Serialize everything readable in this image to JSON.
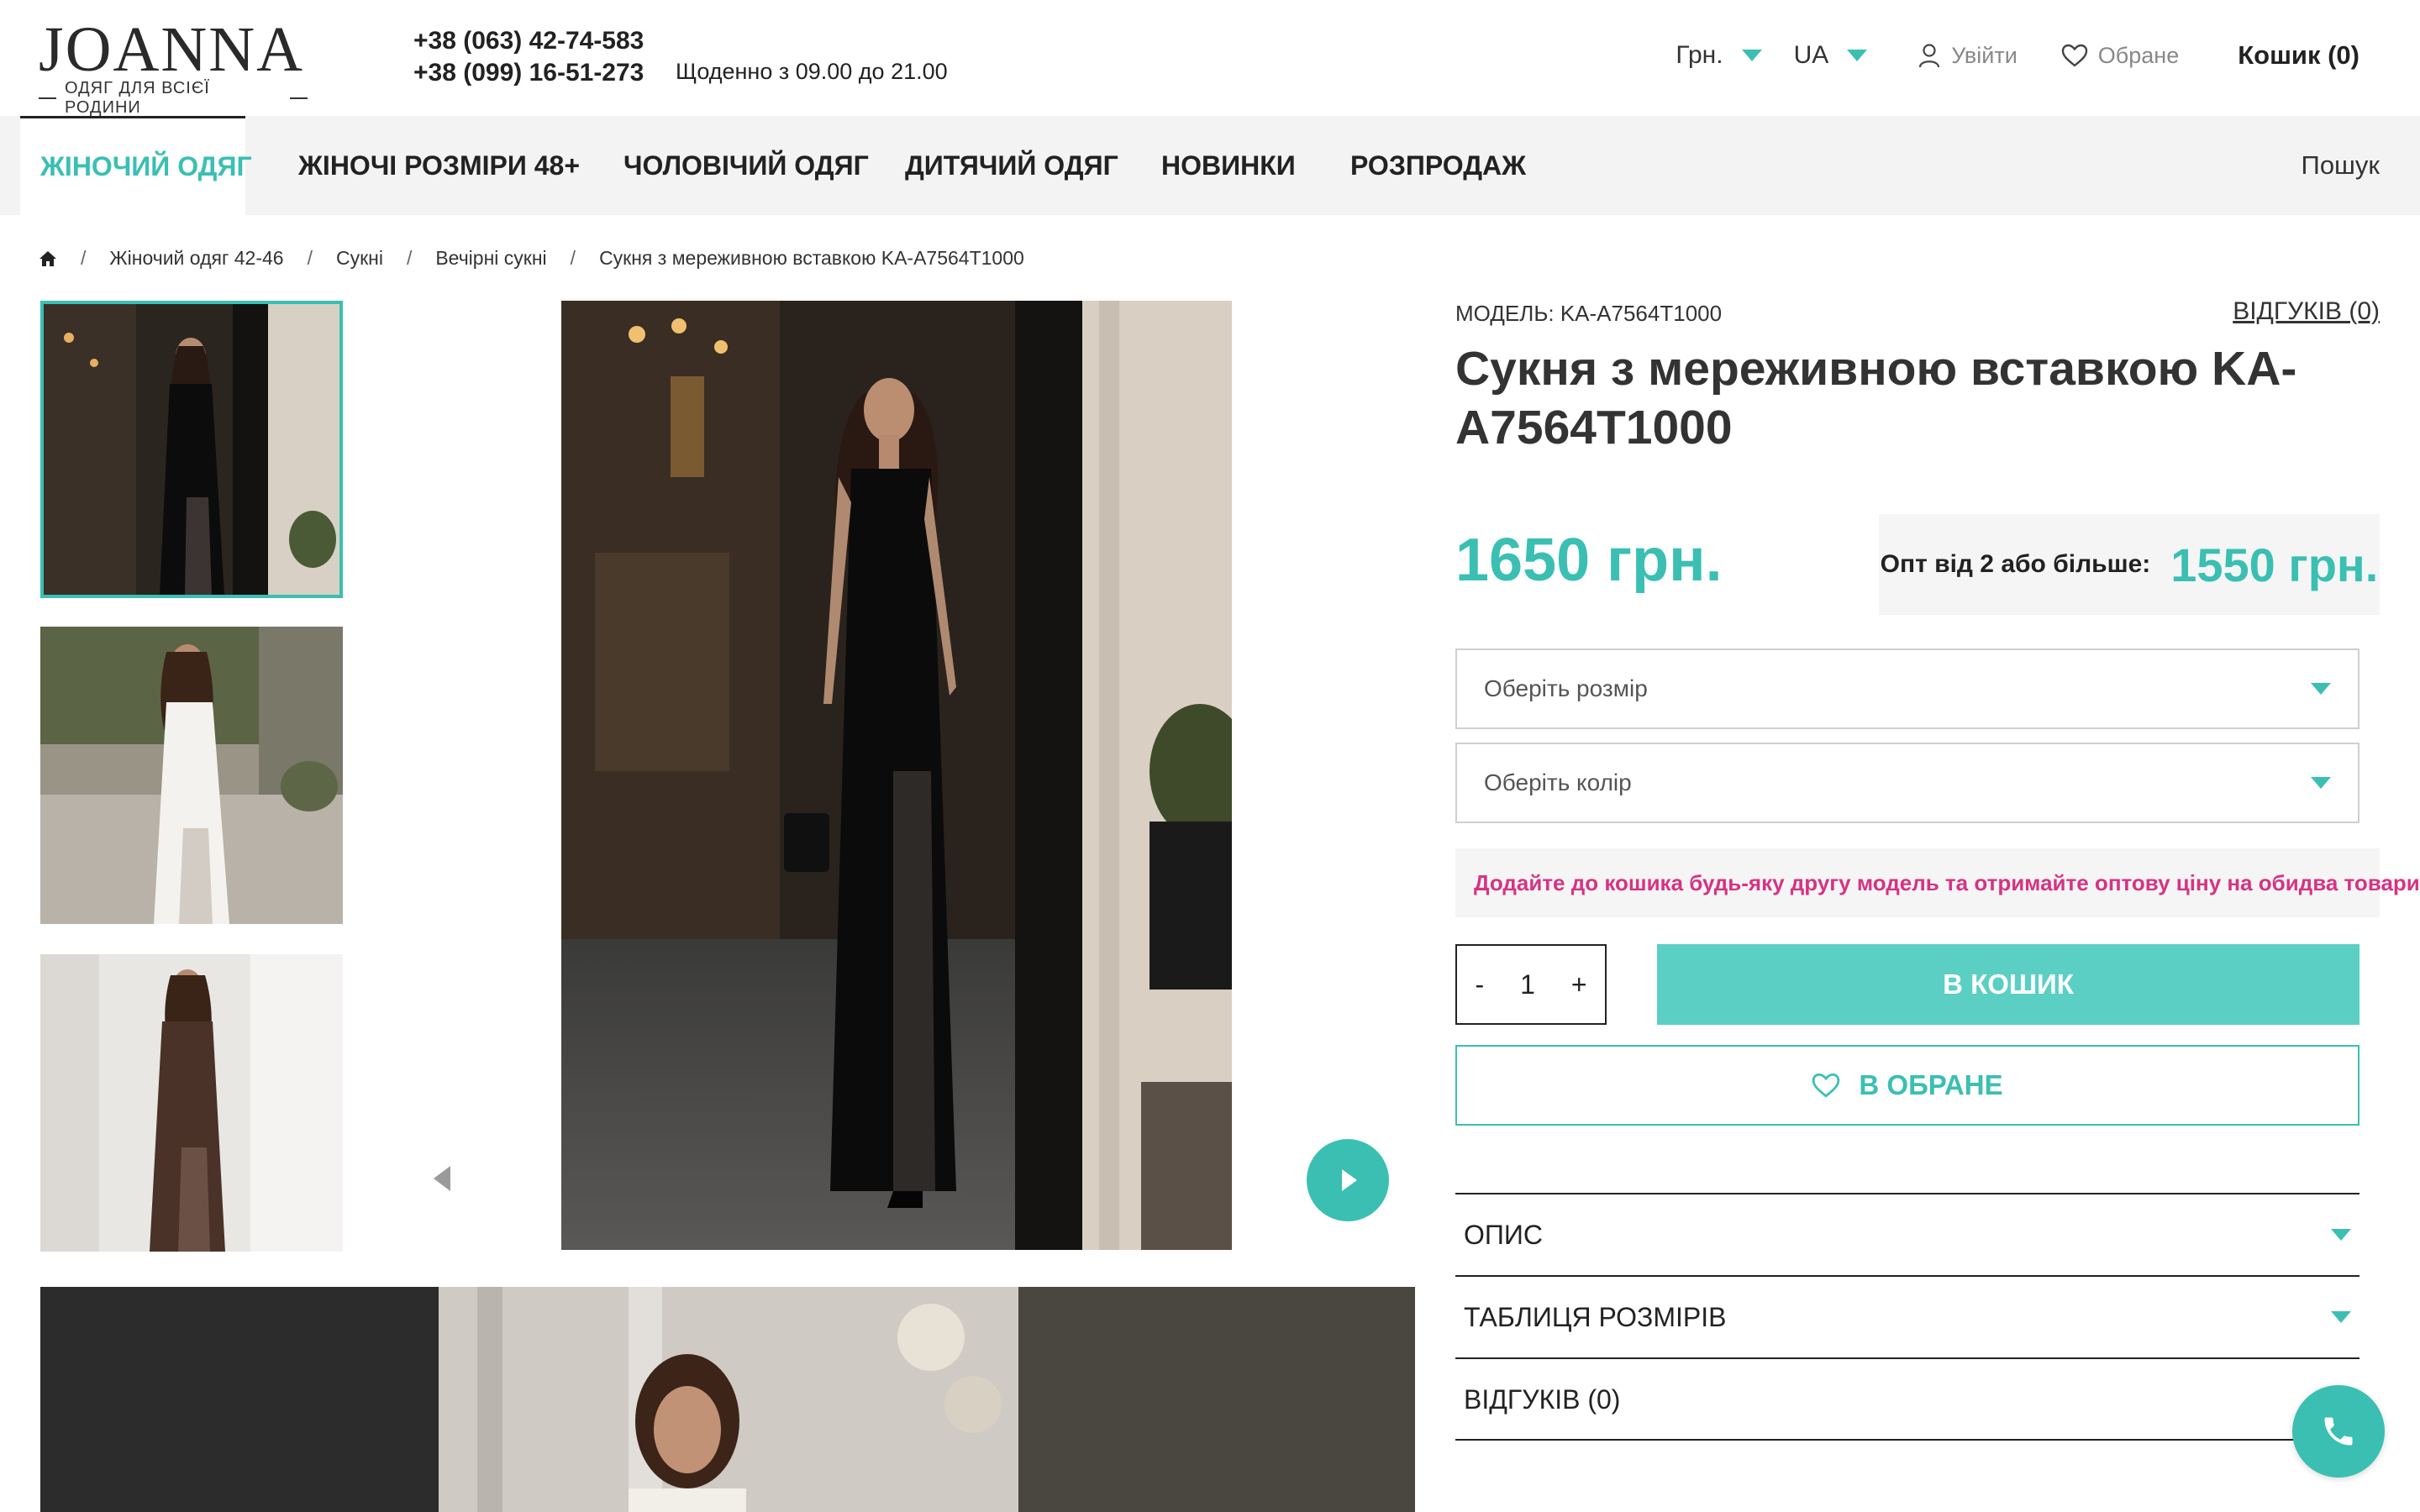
{
  "brand": {
    "name": "JOANNA",
    "tagline": "ОДЯГ ДЛЯ ВСІЄЇ РОДИНИ"
  },
  "contacts": {
    "phone1": "+38 (063) 42-74-583",
    "phone2": "+38 (099) 16-51-273",
    "hours": "Щоденно з 09.00 до 21.00"
  },
  "header": {
    "currency": "Грн.",
    "language": "UA",
    "login": "Увійти",
    "favorites": "Обране",
    "cart": "Кошик (0)"
  },
  "nav": {
    "items": [
      "ЖІНОЧИЙ ОДЯГ",
      "ЖІНОЧІ РОЗМІРИ 48+",
      "ЧОЛОВІЧИЙ ОДЯГ",
      "ДИТЯЧИЙ ОДЯГ",
      "НОВИНКИ",
      "РОЗПРОДАЖ"
    ],
    "search": "Пошук"
  },
  "breadcrumb": [
    "Жіночий одяг 42-46",
    "Сукні",
    "Вечірні сукні",
    "Сукня з мереживною вставкою KA-A7564T1000"
  ],
  "product": {
    "model": "МОДЕЛЬ: KA-A7564T1000",
    "reviews_link": "ВІДГУКІВ (0)",
    "title": "Сукня з мереживною вставкою KA-A7564T1000",
    "price": "1650 грн.",
    "wholesale_label": "Опт від 2 або більше:",
    "wholesale_price": "1550 грн.",
    "size_placeholder": "Оберіть розмір",
    "color_placeholder": "Оберіть колір",
    "promo": "Додайте до кошика будь-яку другу модель та отримайте оптову ціну на обидва товари.",
    "qty_minus": "-",
    "qty": "1",
    "qty_plus": "+",
    "add_to_cart": "В КОШИК",
    "add_to_wishlist": "В ОБРАНЕ"
  },
  "accordion": [
    "ОПИС",
    "ТАБЛИЦЯ РОЗМІРІВ",
    "ВІДГУКІВ (0)"
  ],
  "colors": {
    "accent": "#3bbfb3",
    "button": "#5ccfc5",
    "promo": "#d63384",
    "nav_bg": "#f3f3f3"
  },
  "icons": [
    "home-icon",
    "user-icon",
    "heart-icon",
    "chevron-down-icon",
    "arrow-left-icon",
    "arrow-right-icon",
    "phone-icon"
  ]
}
